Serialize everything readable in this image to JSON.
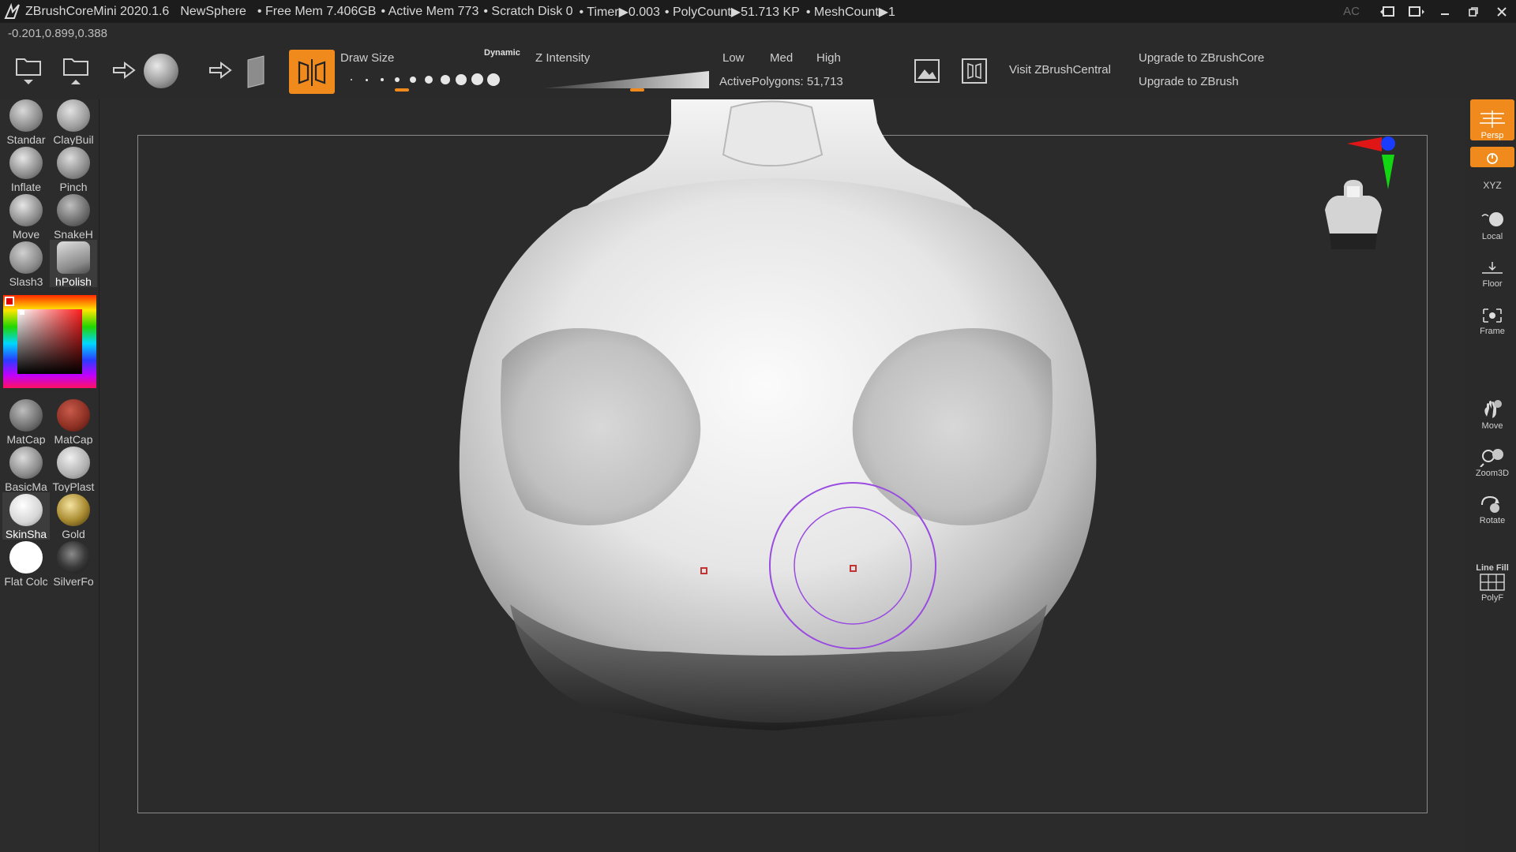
{
  "titlebar": {
    "app": "ZBrushCoreMini 2020.1.6",
    "document": "NewSphere",
    "free_mem": "• Free Mem 7.406GB",
    "active_mem": "• Active Mem 773",
    "scratch": "• Scratch Disk 0",
    "timer": "• Timer▶0.003",
    "polycount": "• PolyCount▶51.713 KP",
    "meshcount": "• MeshCount▶1",
    "ac_label": "AC"
  },
  "coords": "-0.201,0.899,0.388",
  "toolbar": {
    "draw_size_label": "Draw Size",
    "dynamic_label": "Dynamic",
    "z_intensity_label": "Z Intensity",
    "low": "Low",
    "med": "Med",
    "high": "High",
    "active_polygons": "ActivePolygons: 51,713",
    "visit_link": "Visit ZBrushCentral",
    "upgrade_core": "Upgrade to ZBrushCore",
    "upgrade_zbrush": "Upgrade to ZBrush"
  },
  "brushes": [
    {
      "label": "Standar"
    },
    {
      "label": "ClayBuil"
    },
    {
      "label": "Inflate"
    },
    {
      "label": "Pinch"
    },
    {
      "label": "Move"
    },
    {
      "label": "SnakeH"
    },
    {
      "label": "Slash3"
    },
    {
      "label": "hPolish"
    }
  ],
  "materials": [
    {
      "label": "MatCap"
    },
    {
      "label": "MatCap"
    },
    {
      "label": "BasicMa"
    },
    {
      "label": "ToyPlast"
    },
    {
      "label": "SkinSha"
    },
    {
      "label": "Gold"
    },
    {
      "label": "Flat Colc"
    },
    {
      "label": "SilverFo"
    }
  ],
  "right_panel": {
    "persp": "Persp",
    "xyz": "XYZ",
    "local": "Local",
    "floor": "Floor",
    "frame": "Frame",
    "move": "Move",
    "zoom3d": "Zoom3D",
    "rotate": "Rotate",
    "line_fill": "Line Fill",
    "polyf": "PolyF"
  },
  "colors": {
    "accent": "#f08a1c",
    "brush_cursor": "#9a4ce0"
  }
}
